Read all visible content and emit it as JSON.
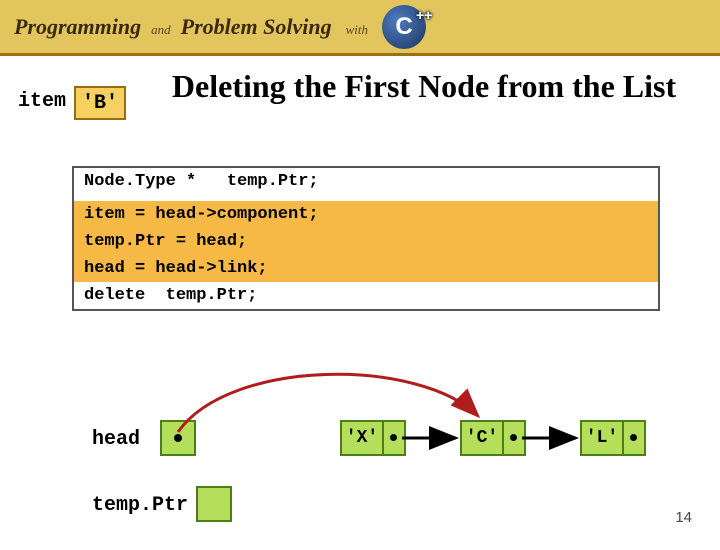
{
  "header": {
    "word1": "Programming",
    "and": "and",
    "word2": "Problem Solving",
    "with": "with",
    "lang": "C",
    "plusplus": "++"
  },
  "slide": {
    "item_label": "item",
    "item_value": "'B'",
    "title": "Deleting the First Node from the List",
    "code": {
      "l1": "Node.Type *   temp.Ptr;",
      "l2": "item = head->component;",
      "l3": "temp.Ptr = head;",
      "l4": "head = head->link;",
      "l5": "delete  temp.Ptr;"
    },
    "list": {
      "head_label": "head",
      "temp_label": "temp.Ptr",
      "nodes": {
        "n1": "'X'",
        "n2": "'C'",
        "n3": "'L'"
      }
    },
    "page_number": "14"
  }
}
